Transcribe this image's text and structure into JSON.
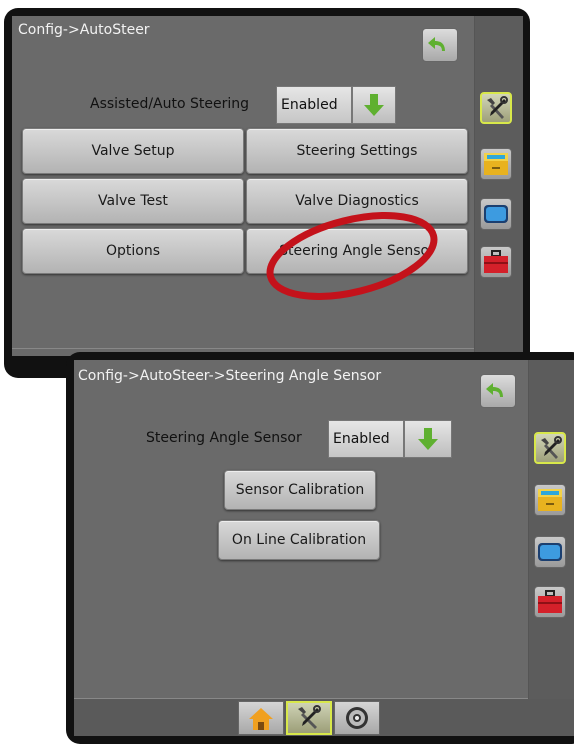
{
  "top_screen": {
    "breadcrumb": "Config->AutoSteer",
    "assisted_label": "Assisted/Auto Steering",
    "assisted_value": "Enabled",
    "buttons": {
      "valve_setup": "Valve Setup",
      "steering_settings": "Steering Settings",
      "valve_test": "Valve Test",
      "valve_diagnostics": "Valve Diagnostics",
      "options": "Options",
      "steering_angle_sensor": "Steering Angle Sensor"
    }
  },
  "bottom_screen": {
    "breadcrumb": "Config->AutoSteer->Steering Angle Sensor",
    "sensor_label": "Steering Angle Sensor",
    "sensor_value": "Enabled",
    "buttons": {
      "sensor_calibration": "Sensor Calibration",
      "online_calibration": "On Line Calibration"
    }
  },
  "colors": {
    "highlight_oval": "#c4121b",
    "active_outline": "#d8e84a",
    "arrow_green": "#5fb030"
  },
  "icons": [
    "back-arrow-icon",
    "tools-icon",
    "console-icon",
    "screen-icon",
    "toolbox-icon",
    "home-icon",
    "gauge-icon"
  ]
}
